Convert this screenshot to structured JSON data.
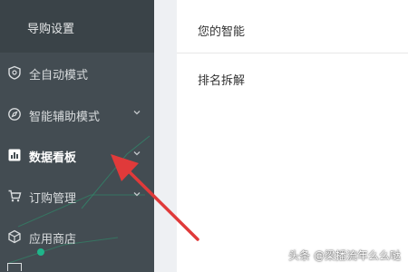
{
  "sidebar": {
    "top_item": "导购设置",
    "items": [
      {
        "label": "全自动模式",
        "icon": "shield-icon",
        "has_chevron": false
      },
      {
        "label": "智能辅助模式",
        "icon": "compass-icon",
        "has_chevron": true
      },
      {
        "label": "数据看板",
        "icon": "chart-board-icon",
        "has_chevron": true,
        "active": true
      },
      {
        "label": "订购管理",
        "icon": "cart-icon",
        "has_chevron": true
      },
      {
        "label": "应用商店",
        "icon": "cube-icon",
        "has_chevron": false
      }
    ]
  },
  "main": {
    "line1": "您的智能",
    "line2": "排名拆解"
  },
  "watermark": "头条 @梁播流年么么哒",
  "colors": {
    "sidebar_bg": "#434c52",
    "annotation_arrow": "#e03a3a"
  }
}
